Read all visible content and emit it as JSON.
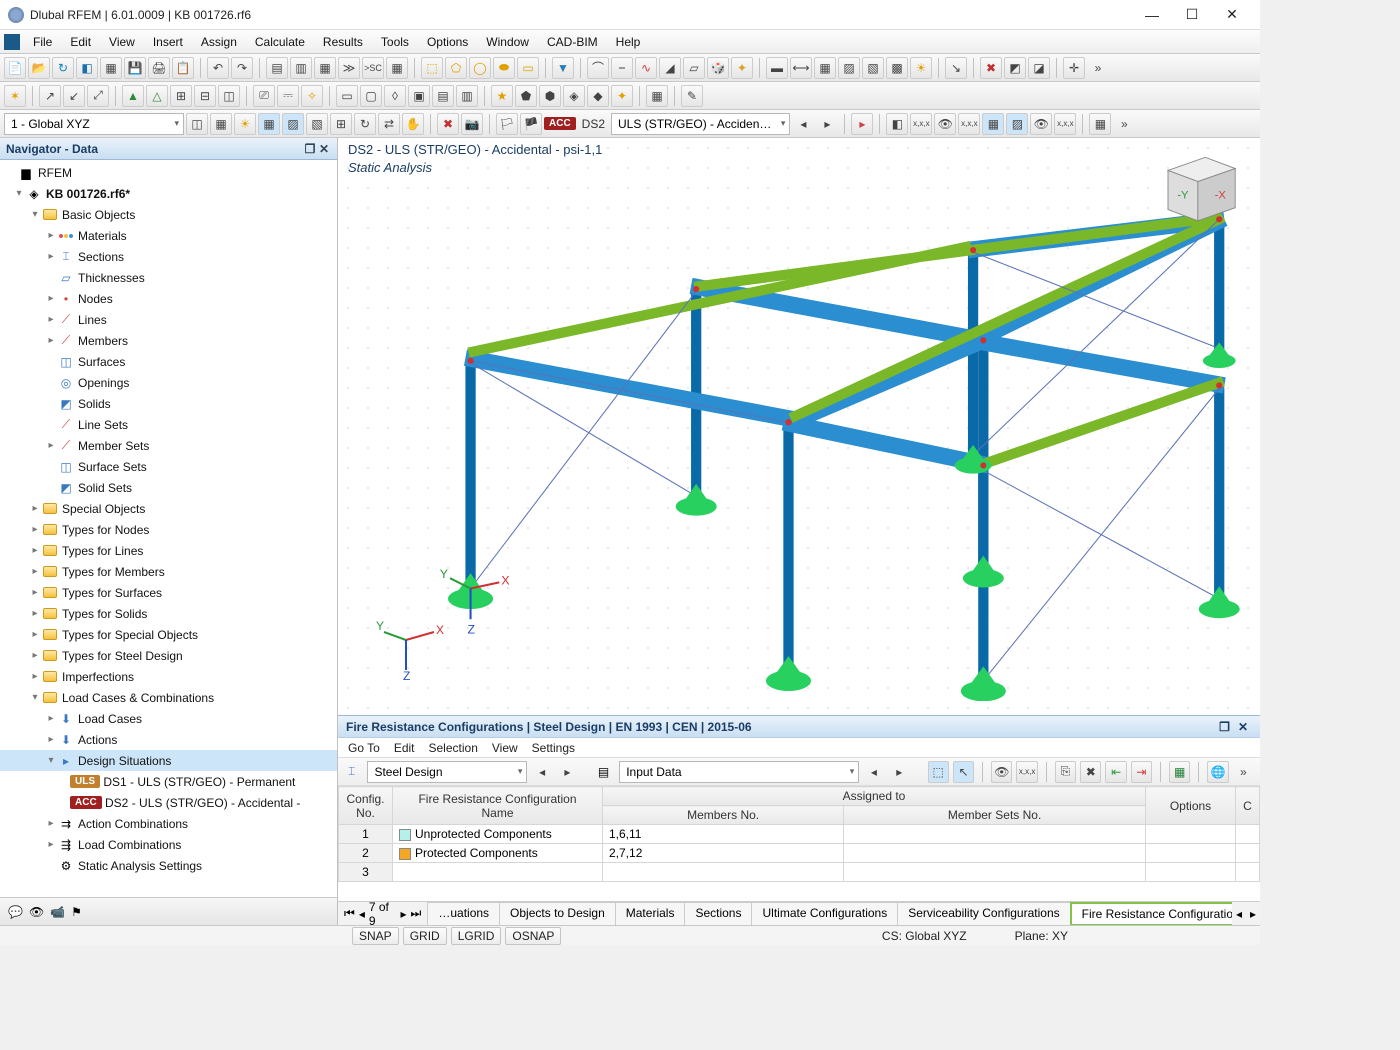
{
  "title": "Dlubal RFEM | 6.01.0009 | KB 001726.rf6",
  "menus": [
    "File",
    "Edit",
    "View",
    "Insert",
    "Assign",
    "Calculate",
    "Results",
    "Tools",
    "Options",
    "Window",
    "CAD-BIM",
    "Help"
  ],
  "cs_dropdown": "1 - Global XYZ",
  "ds_label_short": "DS2",
  "ds_dropdown": "ULS (STR/GEO) - Acciden…",
  "viewport": {
    "line1": "DS2 - ULS (STR/GEO) - Accidental - psi-1,1",
    "line2": "Static Analysis"
  },
  "navigator": {
    "title": "Navigator - Data",
    "root": "RFEM",
    "file": "KB 001726.rf6*",
    "basic_objects": "Basic Objects",
    "items_basic": [
      "Materials",
      "Sections",
      "Thicknesses",
      "Nodes",
      "Lines",
      "Members",
      "Surfaces",
      "Openings",
      "Solids",
      "Line Sets",
      "Member Sets",
      "Surface Sets",
      "Solid Sets"
    ],
    "items_folders": [
      "Special Objects",
      "Types for Nodes",
      "Types for Lines",
      "Types for Members",
      "Types for Surfaces",
      "Types for Solids",
      "Types for Special Objects",
      "Types for Steel Design",
      "Imperfections"
    ],
    "loadcases": "Load Cases & Combinations",
    "lc_children": [
      "Load Cases",
      "Actions",
      "Design Situations"
    ],
    "ds1": "DS1 - ULS (STR/GEO) - Permanent ",
    "ds2": "DS2 - ULS (STR/GEO) - Accidental -",
    "lc_after": [
      "Action Combinations",
      "Load Combinations",
      "Static Analysis Settings"
    ]
  },
  "bottom": {
    "title": "Fire Resistance Configurations | Steel Design | EN 1993 | CEN | 2015-06",
    "menus": [
      "Go To",
      "Edit",
      "Selection",
      "View",
      "Settings"
    ],
    "drop1": "Steel Design",
    "drop2": "Input Data",
    "headers": {
      "no": "Config.\nNo.",
      "name": "Fire Resistance Configuration\nName",
      "assigned": "Assigned to",
      "members": "Members No.",
      "sets": "Member Sets No.",
      "options": "Options",
      "c": "C"
    },
    "rows": [
      {
        "no": "1",
        "color": "#b5f0ea",
        "name": "Unprotected Components",
        "members": "1,6,11",
        "sets": ""
      },
      {
        "no": "2",
        "color": "#f5a623",
        "name": "Protected Components",
        "members": "2,7,12",
        "sets": ""
      },
      {
        "no": "3",
        "color": "",
        "name": "",
        "members": "",
        "sets": ""
      }
    ],
    "pager": "7 of 9",
    "tabs": [
      "…uations",
      "Objects to Design",
      "Materials",
      "Sections",
      "Ultimate Configurations",
      "Serviceability Configurations",
      "Fire Resistance Configurations"
    ],
    "active_tab": 6
  },
  "status": {
    "snaps": [
      "SNAP",
      "GRID",
      "LGRID",
      "OSNAP"
    ],
    "cs": "CS: Global XYZ",
    "plane": "Plane: XY"
  }
}
